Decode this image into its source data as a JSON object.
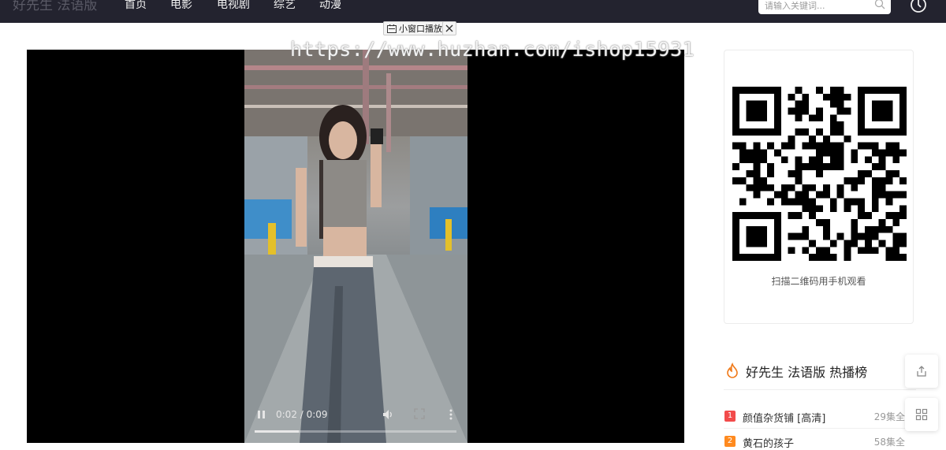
{
  "header": {
    "logo": "好先生 法语版",
    "nav": [
      "首页",
      "电影",
      "电视剧",
      "综艺",
      "动漫"
    ],
    "search_placeholder": "请输入关键词..."
  },
  "overlay": {
    "pip_label": "小窗口播放",
    "watermark": "https://www.huzhan.com/ishop15931"
  },
  "player": {
    "time_display": "0:02 / 0:09",
    "progress": 0.22
  },
  "qr": {
    "caption": "扫描二维码用手机观看"
  },
  "hot": {
    "title": "好先生 法语版 热播榜",
    "items": [
      {
        "rank": "1",
        "name": "颜值杂货铺 [高清]",
        "meta": "29集全",
        "color": "#f24b4b"
      },
      {
        "rank": "2",
        "name": "黄石的孩子",
        "meta": "58集全",
        "color": "#ff8a1f"
      }
    ]
  },
  "colors": {
    "topbar": "#23232f",
    "accent_rank1": "#f24b4b",
    "accent_rank2": "#ff8a1f"
  },
  "icons": [
    "search-icon",
    "history-icon",
    "pip-icon",
    "close-icon",
    "pause-icon",
    "volume-icon",
    "fullscreen-icon",
    "more-icon",
    "qr-code",
    "fire-icon",
    "share-icon",
    "grid-icon"
  ]
}
